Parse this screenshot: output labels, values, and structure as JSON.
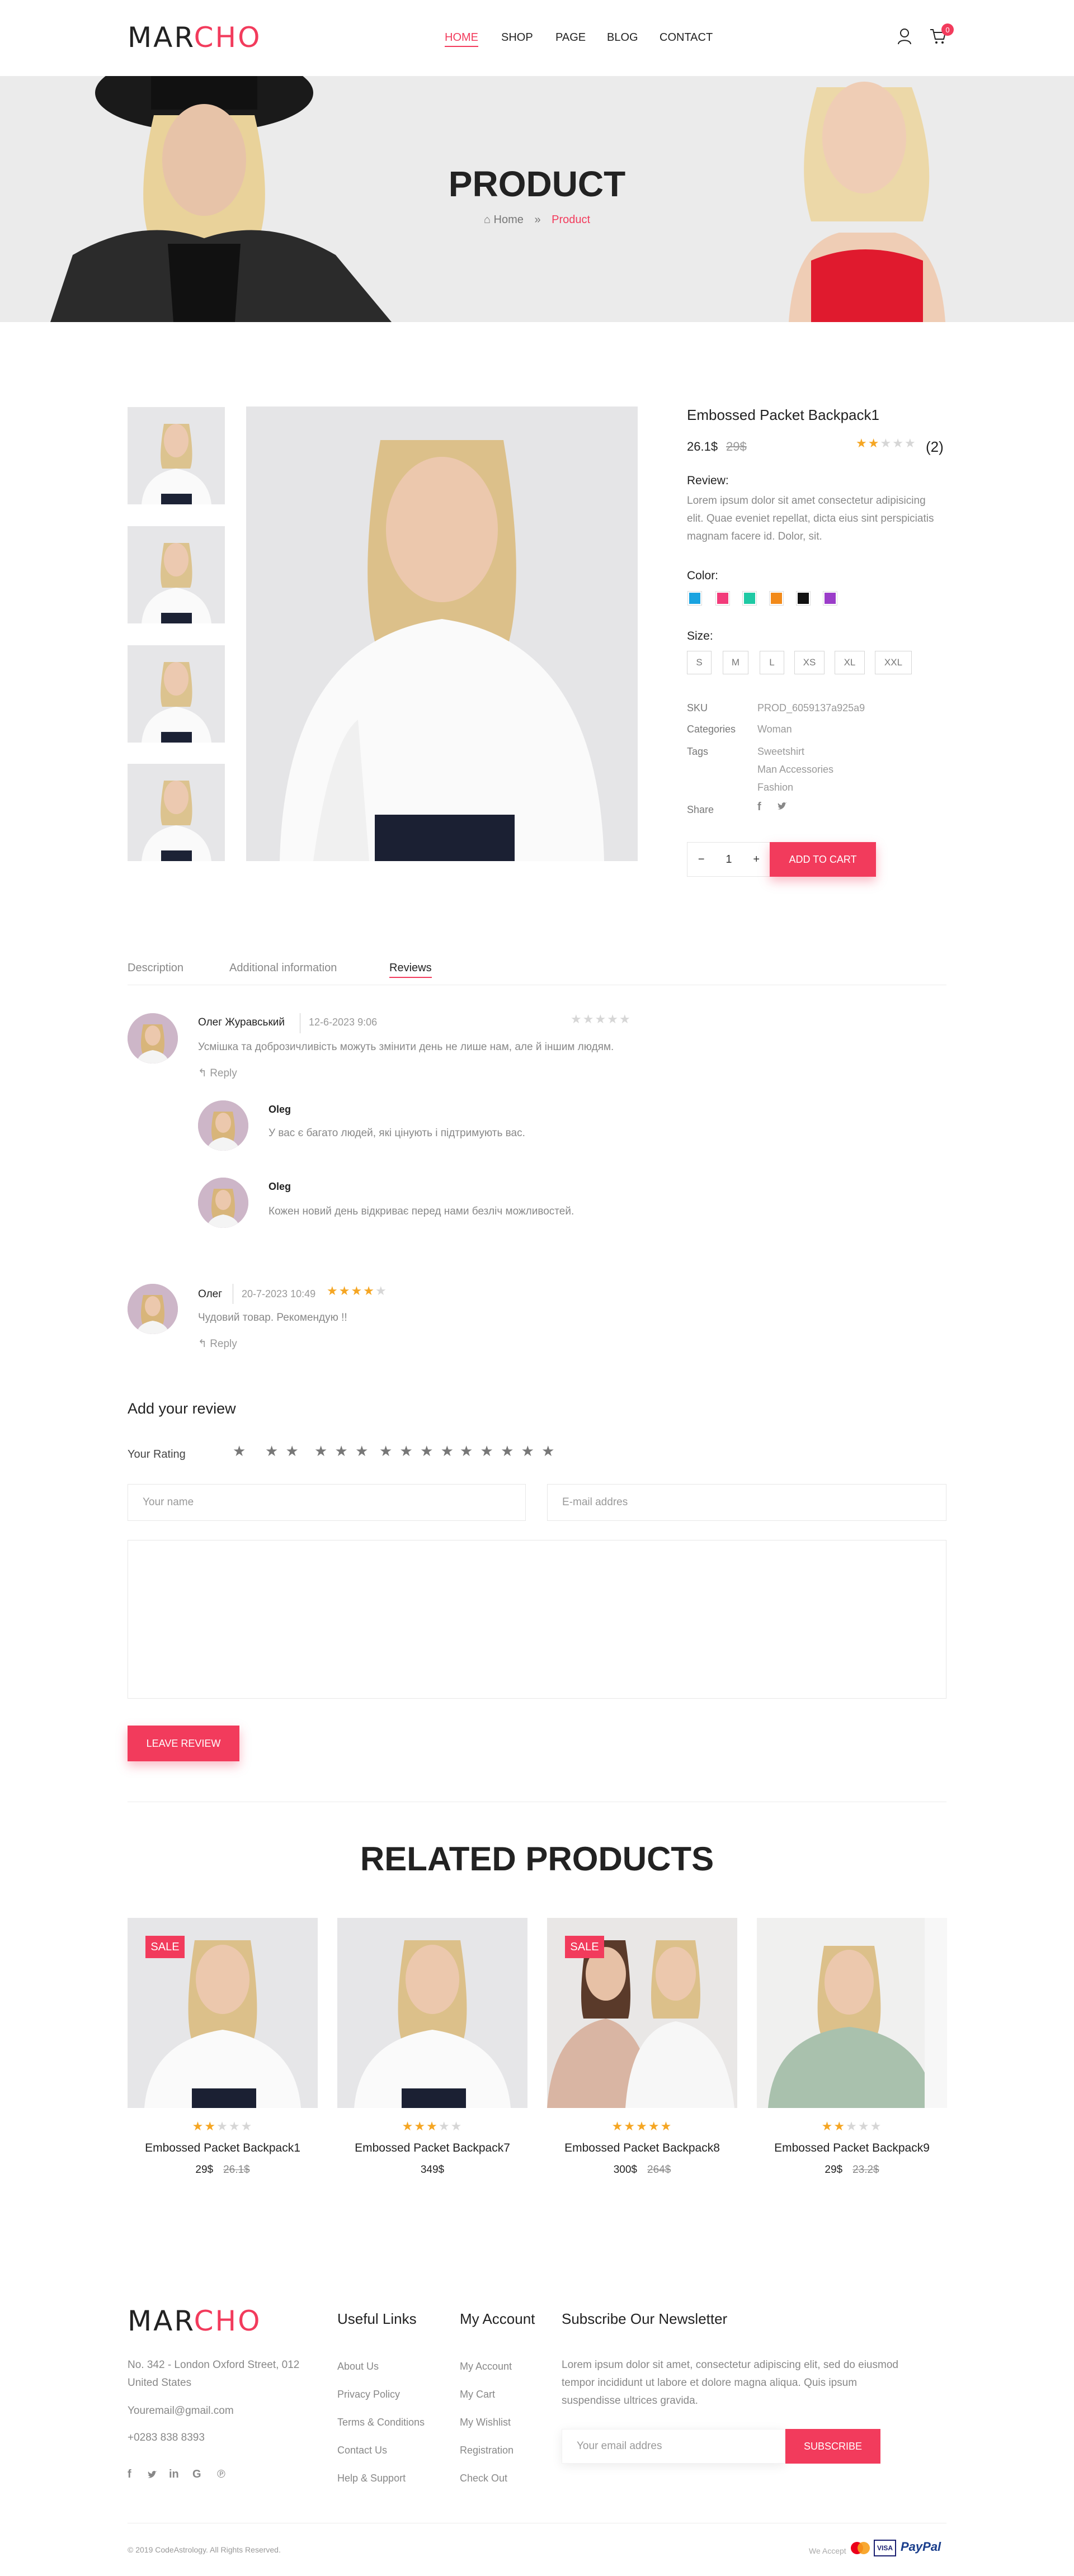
{
  "header": {
    "logo_part1": "MAR",
    "logo_part2": "CHO",
    "nav": [
      "HOME",
      "SHOP",
      "PAGE",
      "BLOG",
      "CONTACT"
    ],
    "cart_count": "0"
  },
  "banner": {
    "title": "PRODUCT",
    "crumb_home": "Home",
    "crumb_sep": "»",
    "crumb_current": "Product"
  },
  "product": {
    "title": "Embossed Packet Backpack1",
    "price": "26.1$",
    "old_price": "29$",
    "rating": 2,
    "review_count": "(2)",
    "review_label": "Review:",
    "description": "Lorem ipsum dolor sit amet consectetur adipisicing elit. Quae eveniet repellat, dicta eius sint perspiciatis magnam facere id. Dolor, sit.",
    "color_label": "Color:",
    "colors": [
      "#1aa3e0",
      "#f23b7a",
      "#1fc9a4",
      "#f28a1a",
      "#111111",
      "#9b3dc9"
    ],
    "size_label": "Size:",
    "sizes": [
      "S",
      "M",
      "L",
      "XS",
      "XL",
      "XXL"
    ],
    "sku_label": "SKU",
    "sku": "PROD_6059137a925a9",
    "categories_label": "Categories",
    "category": "Woman",
    "tags_label": "Tags",
    "tags": [
      "Sweetshirt",
      "Man Accessories",
      "Fashion"
    ],
    "share_label": "Share",
    "qty": "1",
    "qty_minus": "−",
    "qty_plus": "+",
    "add_to_cart": "ADD TO CART"
  },
  "tabs": [
    "Description",
    "Additional information",
    "Reviews"
  ],
  "reviews": [
    {
      "name": "Олег Журавський",
      "date": "12-6-2023 9:06",
      "rating": 0,
      "text": "Усмішка та доброзичливість можуть змінити день не лише нам, але й іншим людям.",
      "reply": "Reply",
      "replies": [
        {
          "name": "Oleg",
          "text": "У вас є багато людей, які цінують і підтримують вас."
        },
        {
          "name": "Oleg",
          "text": "Кожен новий день відкриває перед нами безліч можливостей."
        }
      ]
    },
    {
      "name": "Олег",
      "date": "20-7-2023 10:49",
      "rating": 4,
      "text": "Чудовий товар. Рекомендую !!",
      "reply": "Reply"
    }
  ],
  "review_form": {
    "title": "Add your review",
    "rating_label": "Your Rating",
    "rating_options": [
      "★",
      "★ ★",
      "★ ★ ★",
      "★ ★ ★ ★",
      "★ ★ ★ ★ ★"
    ],
    "name_placeholder": "Your name",
    "email_placeholder": "E-mail addres",
    "submit": "LEAVE REVIEW"
  },
  "related": {
    "title": "RELATED PRODUCTS",
    "items": [
      {
        "name": "Embossed Packet Backpack1",
        "price": "29$",
        "old": "26.1$",
        "sale": "SALE",
        "rating": 2
      },
      {
        "name": "Embossed Packet Backpack7",
        "price": "349$",
        "old": "",
        "sale": "",
        "rating": 3
      },
      {
        "name": "Embossed Packet Backpack8",
        "price": "300$",
        "old": "264$",
        "sale": "SALE",
        "rating": 5
      },
      {
        "name": "Embossed Packet Backpack9",
        "price": "29$",
        "old": "23.2$",
        "sale": "",
        "rating": 2
      }
    ]
  },
  "footer": {
    "logo_part1": "MAR",
    "logo_part2": "CHO",
    "address": "No. 342 - London Oxford Street, 012 United States",
    "email": "Youremail@gmail.com",
    "phone": "+0283 838 8393",
    "useful_title": "Useful Links",
    "useful_links": [
      "About Us",
      "Privacy Policy",
      "Terms & Conditions",
      "Contact Us",
      "Help & Support"
    ],
    "account_title": "My Account",
    "account_links": [
      "My Account",
      "My Cart",
      "My Wishlist",
      "Registration",
      "Check Out"
    ],
    "newsletter_title": "Subscribe Our Newsletter",
    "newsletter_text": "Lorem ipsum dolor sit amet, consectetur adipiscing elit, sed do eiusmod tempor incididunt ut labore et dolore magna aliqua. Quis ipsum suspendisse ultrices gravida.",
    "newsletter_placeholder": "Your email addres",
    "subscribe": "SUBSCRIBE",
    "copyright": "© 2019 CodeAstrology. All Rights Reserved.",
    "we_accept": "We Accept",
    "payment_visa": "VISA",
    "payment_paypal": "PayPal"
  }
}
